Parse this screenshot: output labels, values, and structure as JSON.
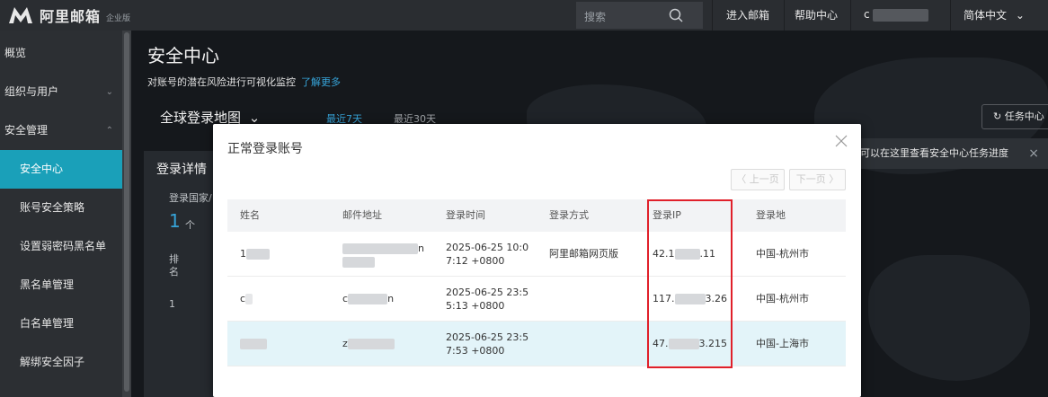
{
  "header": {
    "logo_text": "阿里邮箱",
    "logo_sub": "企业版",
    "search_placeholder": "搜索",
    "nav_enter_mail": "进入邮箱",
    "nav_help": "帮助中心",
    "user_initial": "c",
    "language": "简体中文"
  },
  "sidebar": {
    "items": [
      {
        "label": "概览"
      },
      {
        "label": "组织与用户"
      },
      {
        "label": "安全管理"
      },
      {
        "label": "安全中心"
      },
      {
        "label": "账号安全策略"
      },
      {
        "label": "设置弱密码黑名单"
      },
      {
        "label": "黑名单管理"
      },
      {
        "label": "白名单管理"
      },
      {
        "label": "解绑安全因子"
      }
    ]
  },
  "main": {
    "title": "安全中心",
    "description": "对账号的潜在风险进行可视化监控",
    "learn_more": "了解更多",
    "map_title": "全球登录地图",
    "tab_7days": "最近7天",
    "tab_30days": "最近30天",
    "task_button": "任务中心",
    "notice": "可以在这里查看安全中心任务进度",
    "panel_title": "登录详情",
    "panel_sub": "登录国家/",
    "panel_count": "1",
    "panel_unit": "个",
    "panel_rank_header": "排名",
    "panel_rank_1": "1"
  },
  "modal": {
    "title": "正常登录账号",
    "prev_page": "〈 上一页",
    "next_page": "下一页 〉",
    "columns": [
      "姓名",
      "邮件地址",
      "登录时间",
      "登录方式",
      "登录IP",
      "登录地"
    ],
    "rows": [
      {
        "name": "1",
        "email": "n",
        "time_line1": "2025-06-25 10:0",
        "time_line2": "7:12 +0800",
        "method": "阿里邮箱网页版",
        "ip_head": "42.1",
        "ip_tail": ".11",
        "location": "中国-杭州市"
      },
      {
        "name": "c",
        "email_head": "c",
        "email_tail": "n",
        "time_line1": "2025-06-25 23:5",
        "time_line2": "5:13 +0800",
        "method": "",
        "ip_head": "117.",
        "ip_tail": "3.26",
        "location": "中国-杭州市"
      },
      {
        "name": "",
        "email_head": "z",
        "time_line1": "2025-06-25 23:5",
        "time_line2": "7:53 +0800",
        "method": "",
        "ip_head": "47.",
        "ip_tail": "3.215",
        "location": "中国-上海市"
      }
    ]
  },
  "colors": {
    "accent": "#1aa0b9",
    "link": "#36a3d8",
    "highlight_row": "#e3f4f9",
    "annotation_red": "#e0202a"
  }
}
